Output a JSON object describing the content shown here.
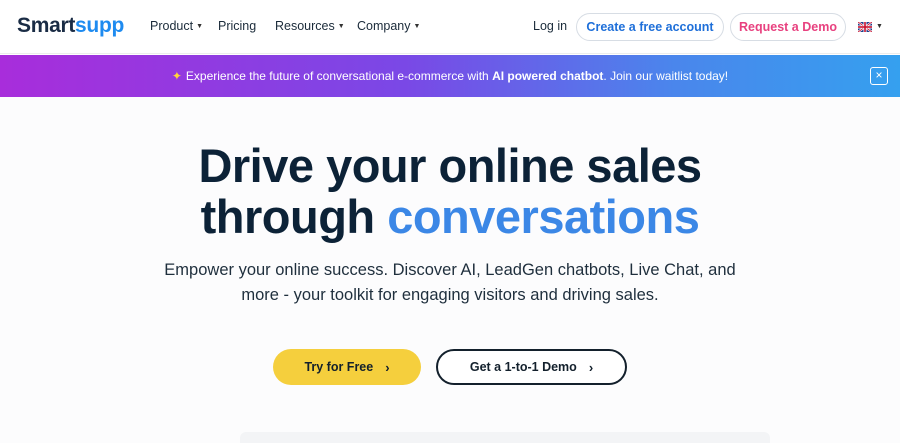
{
  "nav": {
    "logo": {
      "part1": "Smart",
      "part2": "supp"
    },
    "items": [
      {
        "label": "Product",
        "caret": true
      },
      {
        "label": "Pricing",
        "caret": false
      },
      {
        "label": "Resources",
        "caret": true
      },
      {
        "label": "Company",
        "caret": true
      }
    ],
    "login": "Log in",
    "create_account": "Create a free account",
    "request_demo": "Request a Demo",
    "language_icon": "uk-flag-icon"
  },
  "banner": {
    "icon": "sparkle-icon",
    "text_before": "Experience the future of conversational e-commerce with ",
    "text_bold": "AI powered chatbot",
    "text_after": ". Join our waitlist today!",
    "close": "×"
  },
  "hero": {
    "title_line1": "Drive your online sales",
    "title_line2_plain": "through ",
    "title_line2_accent": "conversations",
    "subtitle_line1": "Empower your online success. Discover AI, LeadGen chatbots, Live Chat, and",
    "subtitle_line2": "more - your toolkit for engaging visitors and driving sales.",
    "cta_primary": "Try for Free",
    "cta_secondary": "Get a 1-to-1 Demo",
    "chevron": "›"
  },
  "colors": {
    "brand_blue": "#1e8bf0",
    "accent_blue": "#3b87e6",
    "demo_pink": "#e8417f",
    "cta_yellow": "#f5cf3d",
    "banner_start": "#a82ddb",
    "banner_end": "#35a0ef"
  }
}
